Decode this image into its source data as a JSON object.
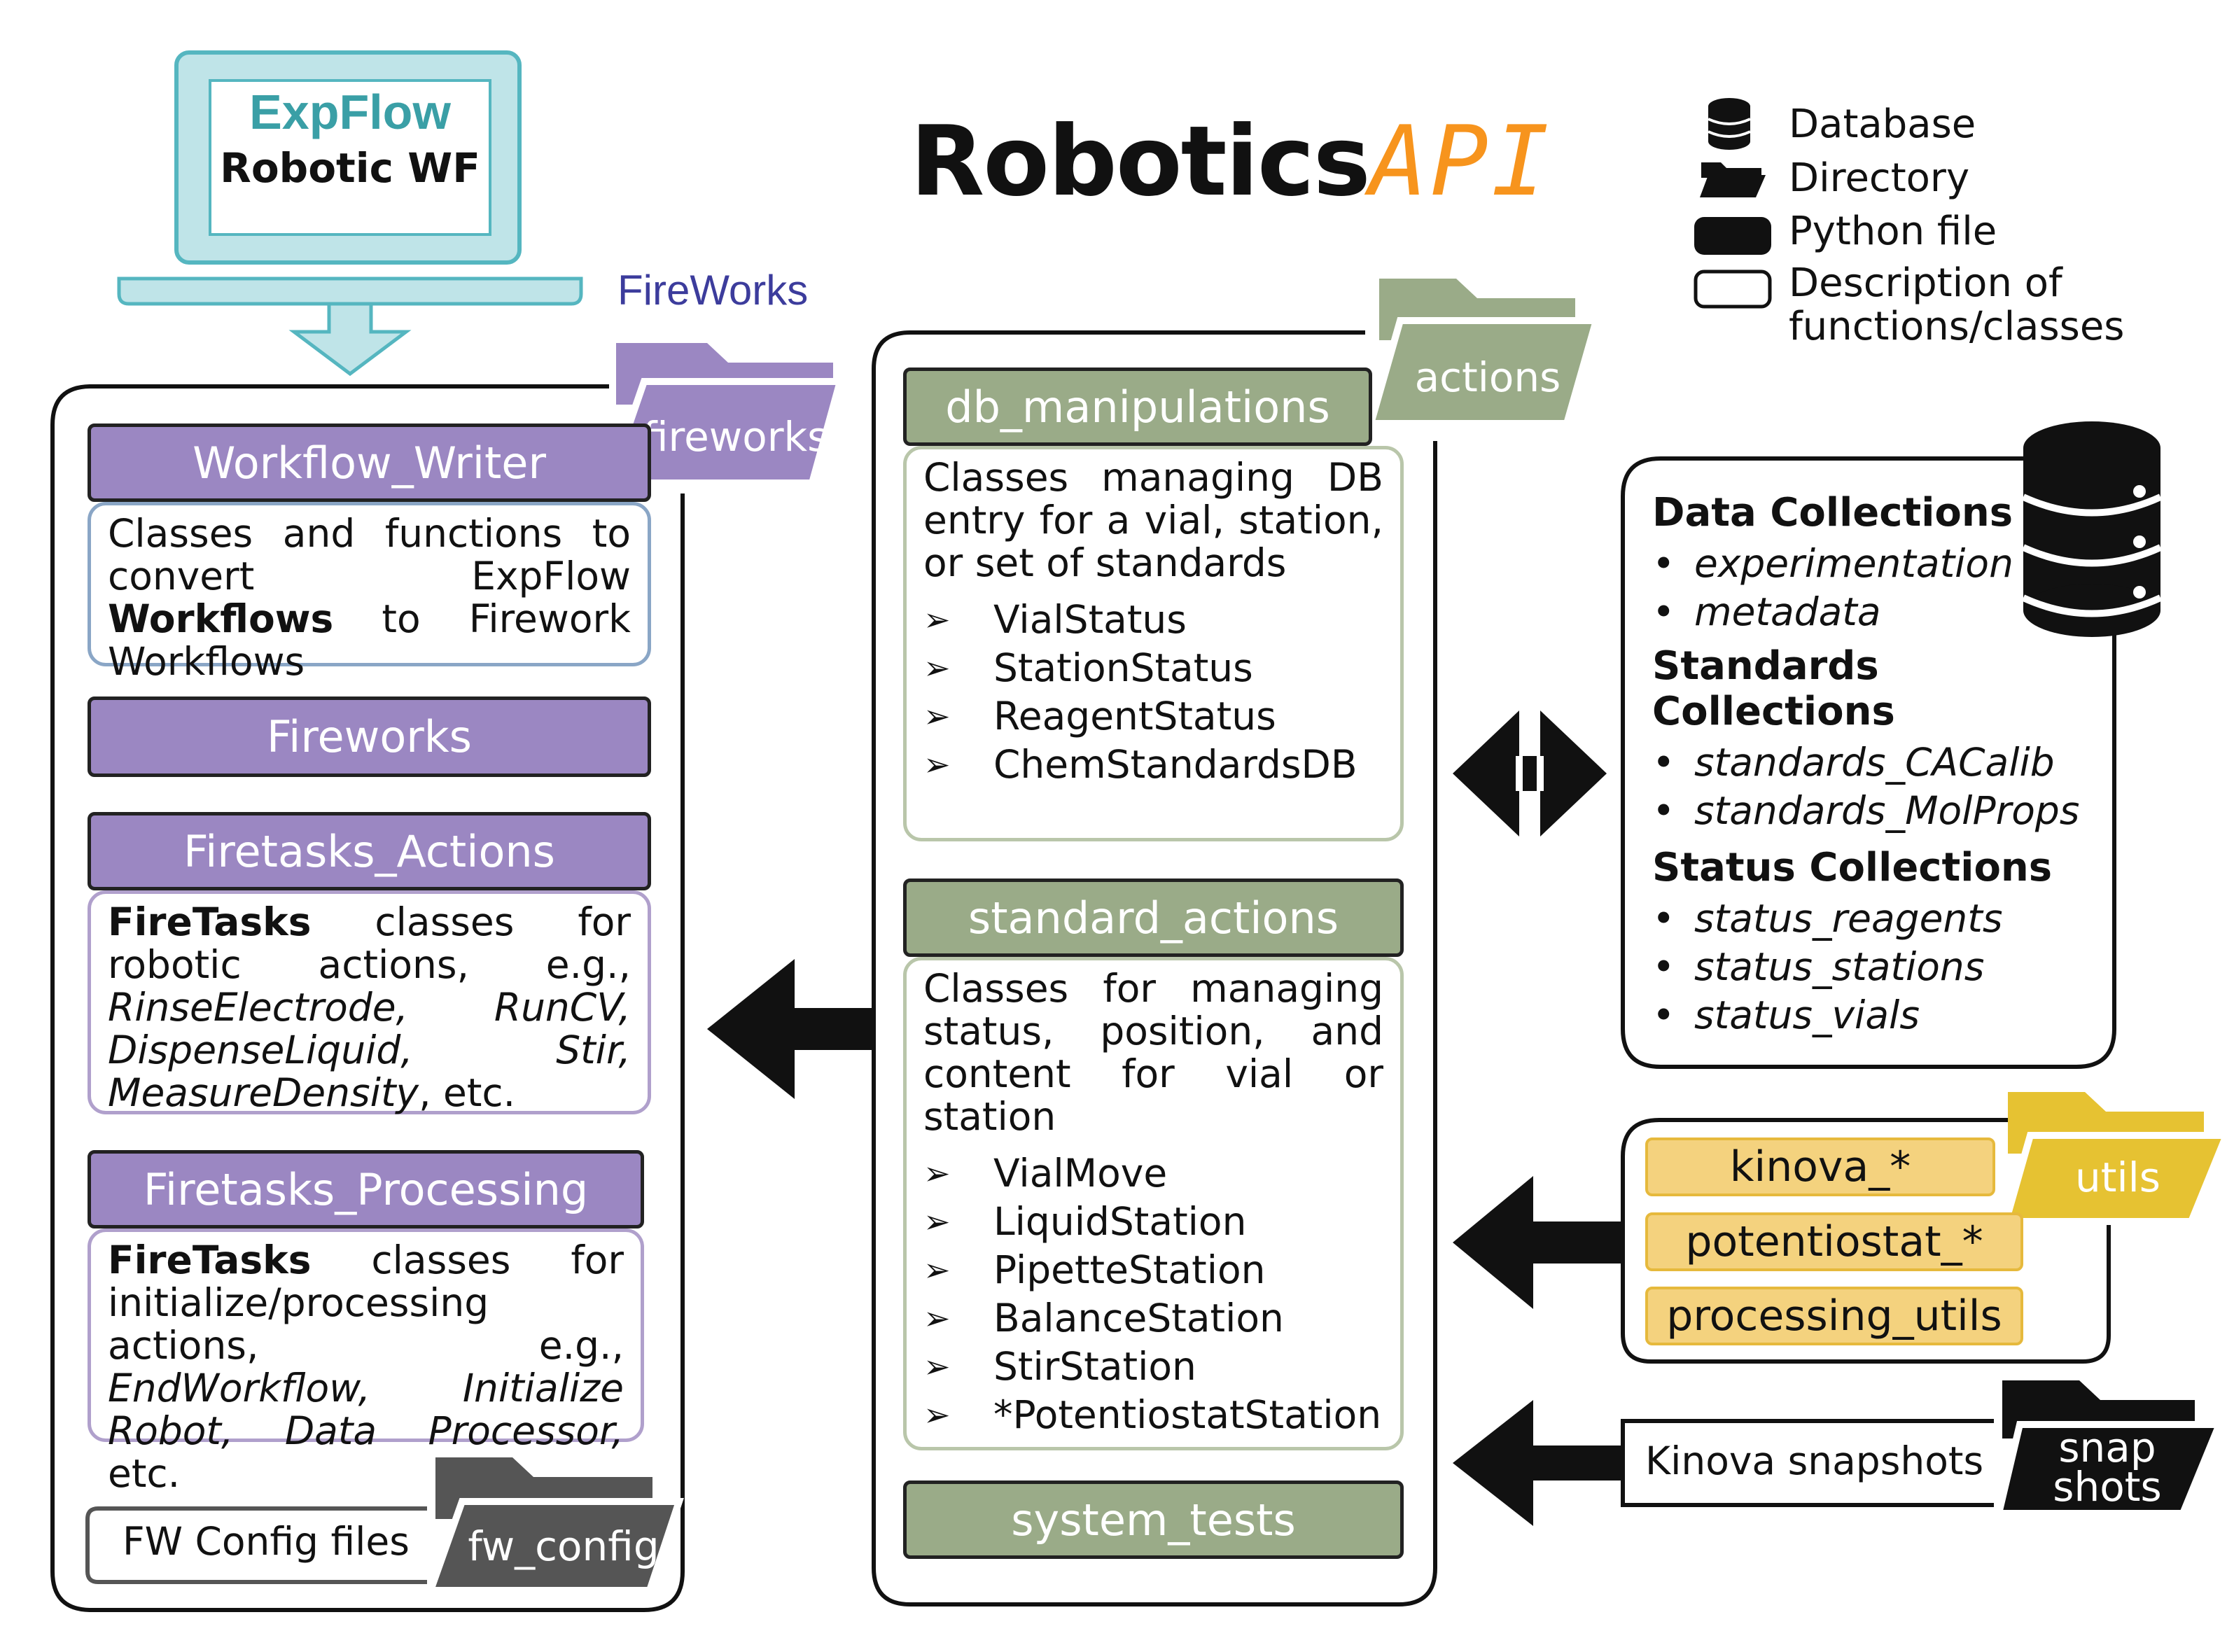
{
  "logo": {
    "brand": "ExpFlow",
    "subtitle": "Robotic WF"
  },
  "fireworks_logo": "FireWorks",
  "title": {
    "main": "Robotics",
    "accent": "API"
  },
  "legend": [
    {
      "icon": "database-icon",
      "label": "Database"
    },
    {
      "icon": "folder-icon",
      "label": "Directory"
    },
    {
      "icon": "python-file-icon",
      "label": "Python file"
    },
    {
      "icon": "description-box-icon",
      "label": "Description of functions/classes"
    }
  ],
  "left_panel": {
    "folder": "fireworks",
    "workflow_writer": {
      "header": "Workflow_Writer",
      "desc_pre": "Classes and functions to convert ExpFlow ",
      "desc_bold": "Workflows",
      "desc_post": " to Firework Workflows"
    },
    "fireworks": {
      "header": "Fireworks"
    },
    "firetasks_actions": {
      "header": "Firetasks_Actions",
      "desc_bold": "FireTasks",
      "desc_text": " classes for robotic actions, e.g., ",
      "desc_examples": "RinseElectrode, RunCV, DispenseLiquid, Stir, MeasureDensity",
      "desc_end": ", etc."
    },
    "firetasks_processing": {
      "header": "Firetasks_Processing",
      "desc_bold": "FireTasks",
      "desc_text": " classes for initialize/processing actions, e.g., ",
      "desc_examples": "EndWorkflow, Initialize Robot, Data Processor,",
      "desc_end": " etc."
    },
    "config": {
      "label": "FW Config files",
      "folder": "fw_config"
    }
  },
  "middle_panel": {
    "folder": "actions",
    "db_manipulations": {
      "header": "db_manipulations",
      "desc": "Classes managing DB entry for a vial, station, or set of standards",
      "items": [
        "VialStatus",
        "StationStatus",
        "ReagentStatus",
        "ChemStandardsDB"
      ]
    },
    "standard_actions": {
      "header": "standard_actions",
      "desc": "Classes for managing status, position, and content for vial or station",
      "items": [
        "VialMove",
        "LiquidStation",
        "PipetteStation",
        "BalanceStation",
        "StirStation",
        "*PotentiostatStation"
      ]
    },
    "system_tests": {
      "header": "system_tests"
    },
    "marker": "➢"
  },
  "right_panel": {
    "database": {
      "groups": [
        {
          "title": "Data Collections",
          "items": [
            "experimentation",
            "metadata"
          ]
        },
        {
          "title": "Standards Collections",
          "items": [
            "standards_CACalib",
            "standards_MolProps"
          ]
        },
        {
          "title": "Status Collections",
          "items": [
            "status_reagents",
            "status_stations",
            "status_vials"
          ]
        }
      ]
    },
    "utils": {
      "folder": "utils",
      "files": [
        "kinova_*",
        "potentiostat_*",
        "processing_utils"
      ]
    },
    "snapshots": {
      "label": "Kinova snapshots",
      "folder_line1": "snap",
      "folder_line2": "shots"
    }
  },
  "colors": {
    "purple": "#9b87c2",
    "green": "#9aab88",
    "yellow": "#f4d27e",
    "utils_folder": "#e6c232",
    "monitor": "#bfe4e8",
    "api_orange": "#f7941d",
    "expflow_teal": "#3a9fa6"
  }
}
